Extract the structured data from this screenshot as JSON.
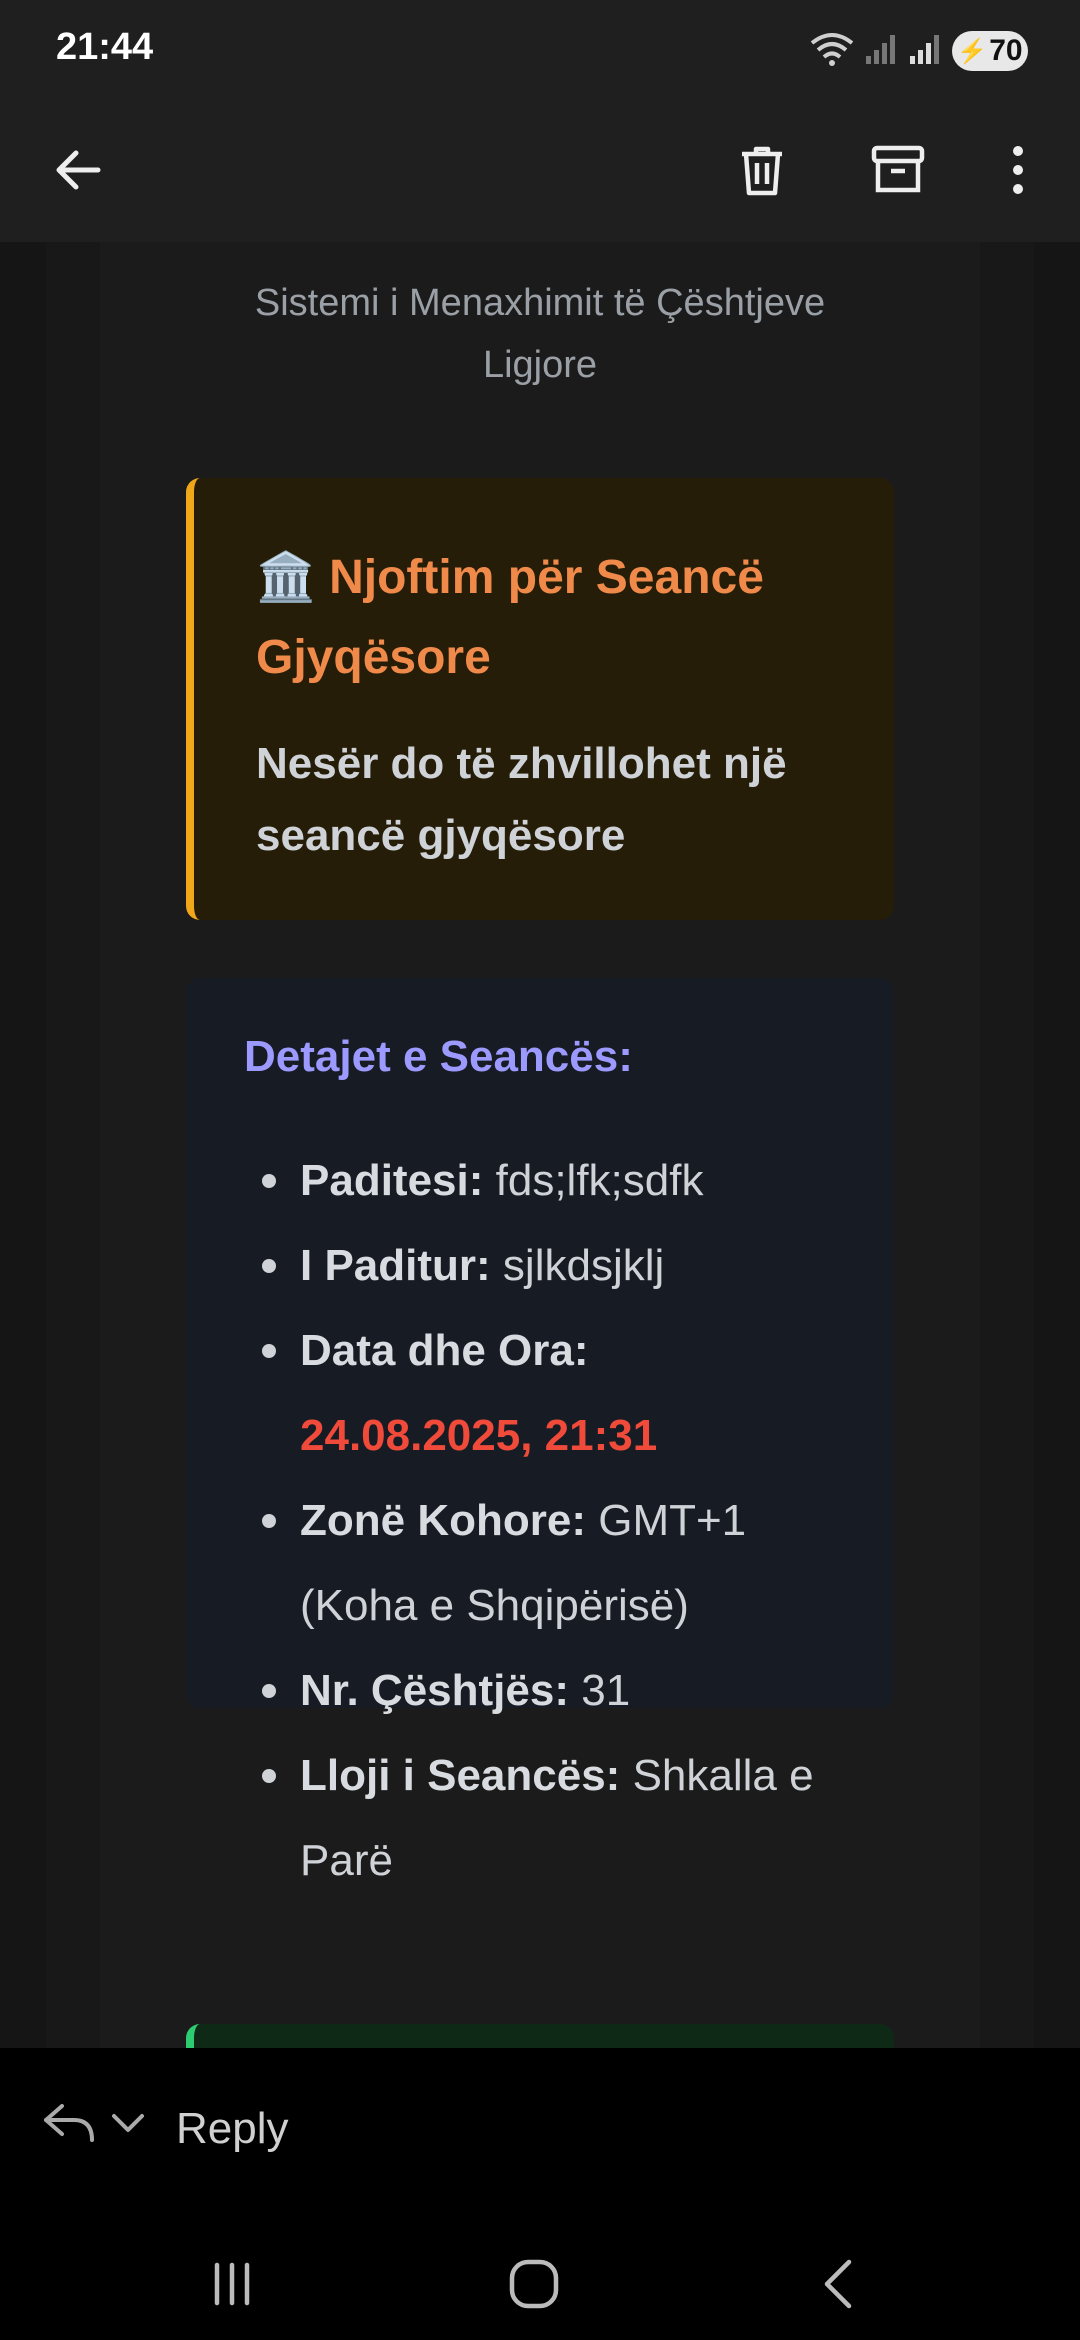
{
  "status_bar": {
    "time": "21:44",
    "battery": "70"
  },
  "toolbar": {
    "back": "back",
    "delete": "delete",
    "archive": "archive",
    "more": "more"
  },
  "email": {
    "subtitle": "Sistemi i Menaxhimit të Çështjeve Ligjore",
    "alert": {
      "emoji": "🏛️",
      "title": "Njoftim për Seancë Gjyqësore",
      "subtitle": "Nesër do të zhvillohet një seancë gjyqësore"
    },
    "details": {
      "title": "Detajet e Seancës:",
      "items": [
        {
          "label": "Paditesi:",
          "value": "fds;lfk;sdfk"
        },
        {
          "label": "I Paditur:",
          "value": "sjlkdsjklj"
        },
        {
          "label": "Data dhe Ora:",
          "value": "24.08.2025, 21:31"
        },
        {
          "label": "Zonë Kohore:",
          "value": "GMT+1 (Koha e Shqipërisë)"
        },
        {
          "label": "Nr. Çështjës:",
          "value": "31"
        },
        {
          "label": "Lloji i Seancës:",
          "value": "Shkalla e Parë"
        }
      ]
    }
  },
  "reply": {
    "label": "Reply"
  },
  "colors": {
    "alert_border": "#f0a71a",
    "alert_title": "#f08a4b",
    "details_title": "#9c99ff",
    "date_highlight": "#f04a3a"
  }
}
